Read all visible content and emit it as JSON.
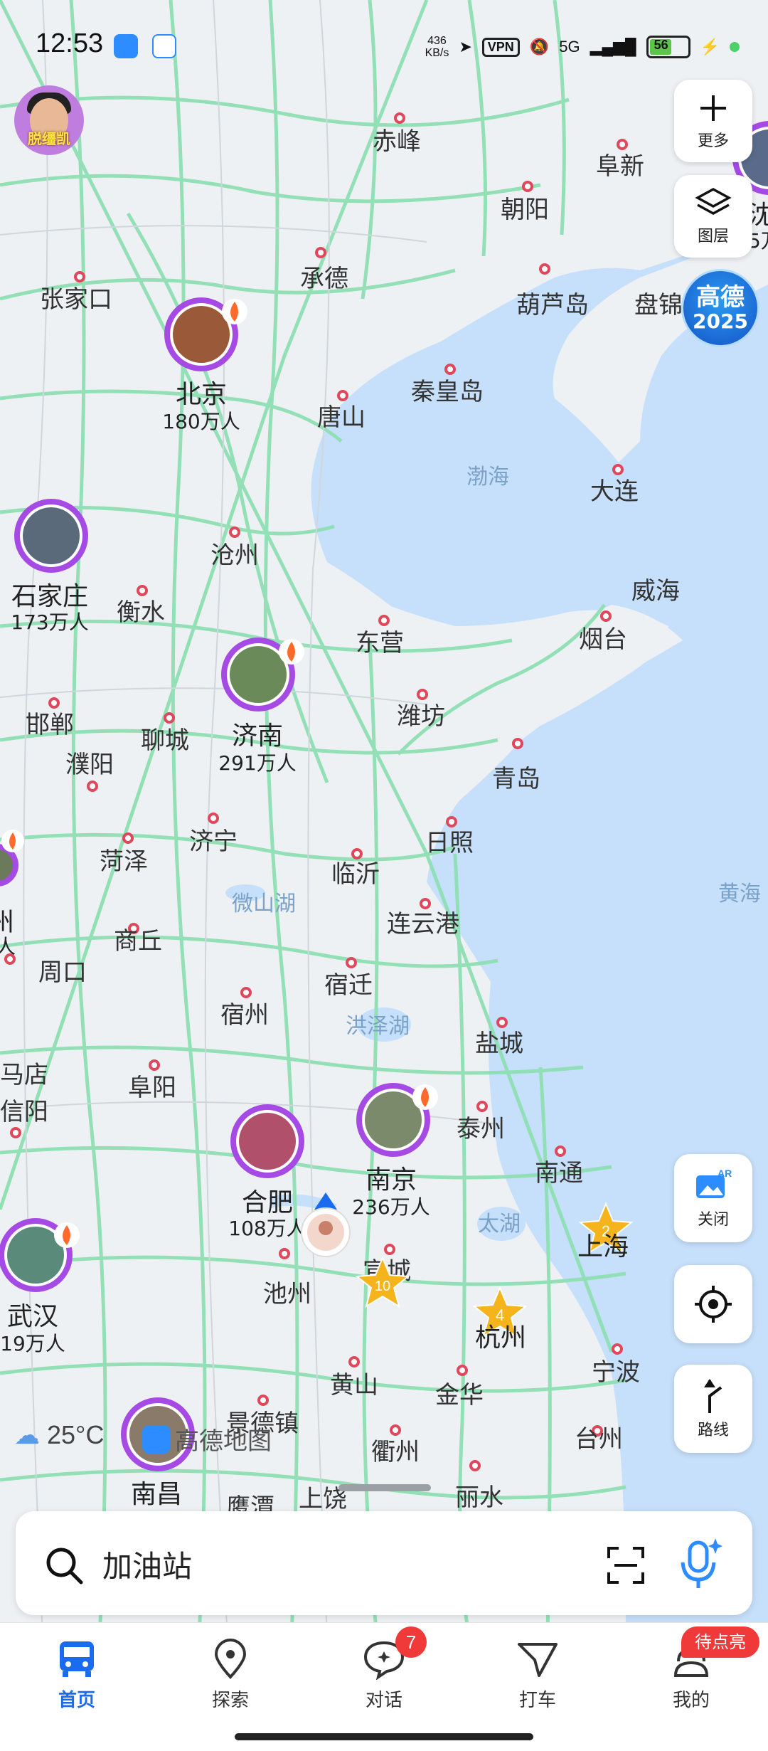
{
  "status_bar": {
    "time": "12:53",
    "net_speed_value": "436",
    "net_speed_unit": "KB/s",
    "vpn": "VPN",
    "network": "5G",
    "battery": "56"
  },
  "profile": {
    "avatar_label": "脱缰凯"
  },
  "map_controls": {
    "more": "更多",
    "layers": "图层",
    "ar_close": "关闭",
    "route": "路线"
  },
  "event_badge": {
    "line1": "高德",
    "line2": "2025"
  },
  "cities": {
    "chifeng": "赤峰",
    "fuxin": "阜新",
    "chaoyang": "朝阳",
    "zhangjiakou": "张家口",
    "chengde": "承德",
    "huludao": "葫芦岛",
    "panjin": "盘锦",
    "qinhuangdao": "秦皇岛",
    "tangshan": "唐山",
    "dalian": "大连",
    "cangzhou": "沧州",
    "hengshui": "衡水",
    "weihai": "威海",
    "dongying": "东营",
    "yantai": "烟台",
    "handan": "邯郸",
    "liaocheng": "聊城",
    "weifang": "潍坊",
    "puyang": "濮阳",
    "qingdao": "青岛",
    "jining": "济宁",
    "heze": "菏泽",
    "rizhao": "日照",
    "linyi": "临沂",
    "shangqiu": "商丘",
    "lianyungang": "连云港",
    "zhoukou": "周口",
    "suqian": "宿迁",
    "suzhou": "宿州",
    "yancheng": "盐城",
    "zhumadian": "马店",
    "fuyang": "阜阳",
    "xinyang": "信阳",
    "taizhou": "泰州",
    "nantong": "南通",
    "chizhou": "池州",
    "xuancheng": "宣城",
    "hangzhou": "杭州",
    "ningbo": "宁波",
    "huangshan": "黄山",
    "jinhua": "金华",
    "jingdezhen": "景德镇",
    "quzhou": "衢州",
    "taizhou_zj": "台州",
    "shangrao": "上饶",
    "lishui": "丽水",
    "yingtan": "鹰潭"
  },
  "water": {
    "bohai": "渤海",
    "huanghai": "黄海",
    "weishan": "微山湖",
    "hongze": "洪泽湖",
    "taihu": "太湖"
  },
  "hot_cities": [
    {
      "name": "北京",
      "count": "180万人"
    },
    {
      "name": "石家庄",
      "count": "173万人"
    },
    {
      "name": "济南",
      "count": "291万人"
    },
    {
      "name": "合肥",
      "count": "108万人"
    },
    {
      "name": "南京",
      "count": "236万人"
    },
    {
      "name": "武汉",
      "count": "19万人"
    },
    {
      "name": "南昌",
      "count": ""
    }
  ],
  "edge_cities": {
    "shenyang_part": "沈阳",
    "shenyang_count_part": "5万",
    "west_part": "州",
    "west_count_part": "人"
  },
  "highlight": {
    "shanghai": "上海",
    "shanghai_rank": "2",
    "hangzhou_rank": "4",
    "xuancheng_rank": "10"
  },
  "weather": {
    "temp": "25°C"
  },
  "watermark": "高德地图",
  "search": {
    "text": "加油站"
  },
  "nav": {
    "home": "首页",
    "explore": "探索",
    "chat": "对话",
    "chat_badge": "7",
    "taxi": "打车",
    "mine": "我的",
    "promo": "待点亮"
  },
  "colors": {
    "accent": "#1a6bf0",
    "land": "#eef1f4",
    "sea": "#c6dffa",
    "road": "#8fe0b4",
    "hot_ring": "#a64ae6",
    "badge_red": "#f03a3a"
  }
}
